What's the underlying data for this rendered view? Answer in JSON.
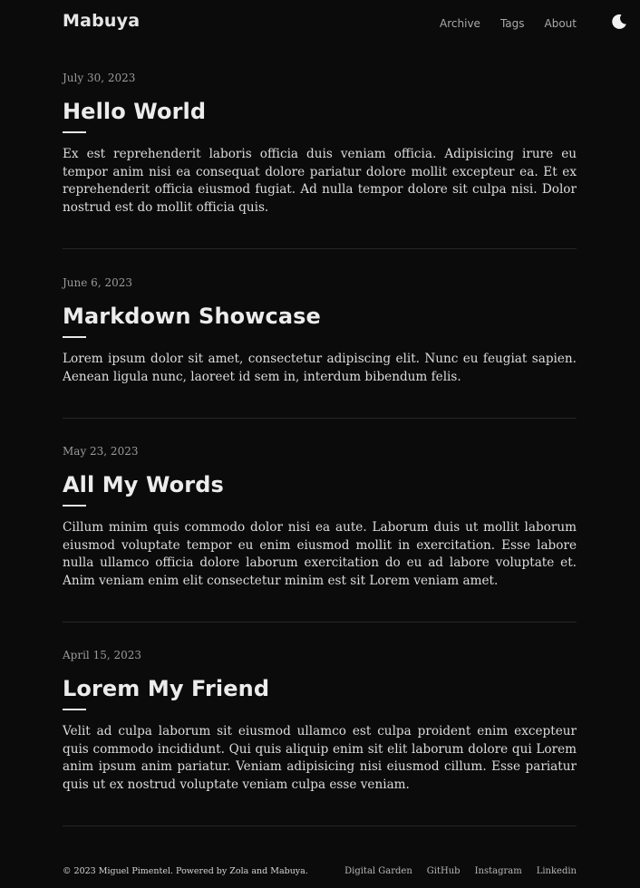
{
  "header": {
    "site_title": "Mabuya",
    "nav": [
      "Archive",
      "Tags",
      "About"
    ],
    "theme_icon": "moon-icon"
  },
  "posts": [
    {
      "date": "July 30, 2023",
      "title": "Hello World",
      "summary": "Ex est reprehenderit laboris officia duis veniam officia. Adipisicing irure eu tempor anim nisi ea consequat dolore pariatur dolore mollit excepteur ea. Et ex reprehenderit officia eiusmod fugiat. Ad nulla tempor dolore sit culpa nisi. Dolor nostrud est do mollit officia quis."
    },
    {
      "date": "June 6, 2023",
      "title": "Markdown Showcase",
      "summary": "Lorem ipsum dolor sit amet, consectetur adipiscing elit. Nunc eu feugiat sapien. Aenean ligula nunc, laoreet id sem in, interdum bibendum felis."
    },
    {
      "date": "May 23, 2023",
      "title": "All My Words",
      "summary": "Cillum minim quis commodo dolor nisi ea aute. Laborum duis ut mollit laborum eiusmod voluptate tempor eu enim eiusmod mollit in exercitation. Esse labore nulla ullamco officia dolore laborum exercitation do eu ad labore voluptate et. Anim veniam enim elit consectetur minim est sit Lorem veniam amet."
    },
    {
      "date": "April 15, 2023",
      "title": "Lorem My Friend",
      "summary": "Velit ad culpa laborum sit eiusmod ullamco est culpa proident enim excepteur quis commodo incididunt. Qui quis aliquip enim sit elit laborum dolore qui Lorem anim ipsum anim pariatur. Veniam adipisicing nisi eiusmod cillum. Esse pariatur quis ut ex nostrud voluptate veniam culpa esse veniam."
    }
  ],
  "footer": {
    "copyright": "© 2023 Miguel Pimentel. Powered by ",
    "zola": "Zola",
    "and": " and ",
    "mabuya": "Mabuya",
    "period": ".",
    "links": [
      "Digital Garden",
      "GitHub",
      "Instagram",
      "Linkedin"
    ]
  }
}
